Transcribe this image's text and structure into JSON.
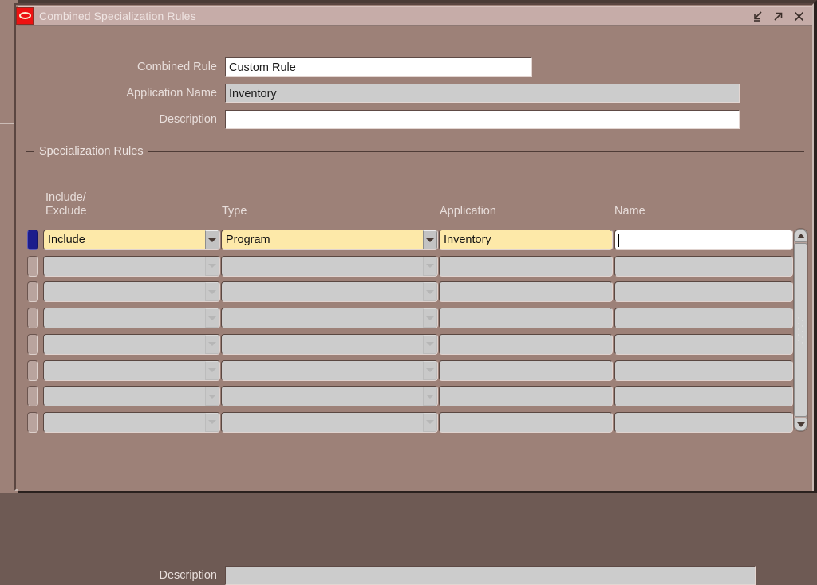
{
  "window": {
    "title": "Combined Specialization Rules",
    "logo_icon": "oracle-logo-icon",
    "controls": [
      {
        "name": "minimize",
        "icon": "minimize-arrow-icon"
      },
      {
        "name": "maximize",
        "icon": "maximize-arrow-icon"
      },
      {
        "name": "close",
        "icon": "close-x-icon"
      }
    ]
  },
  "colors": {
    "canvas": "#9d8178",
    "titlebar": "#c6aca8",
    "field_active": "#ffffff",
    "field_readonly": "#cccccc",
    "field_highlight": "#fde9a9",
    "record_indicator": "#1c1c8c",
    "label_text": "#e8dedb"
  },
  "header_fields": [
    {
      "label": "Combined Rule",
      "value": "Custom Rule",
      "state": "editable"
    },
    {
      "label": "Application Name",
      "value": "Inventory",
      "state": "readonly"
    },
    {
      "label": "Description",
      "value": "",
      "state": "editable"
    }
  ],
  "group": {
    "title": "Specialization Rules"
  },
  "grid": {
    "columns": [
      {
        "key": "include_exclude",
        "label_line1": "Include/",
        "label_line2": "Exclude"
      },
      {
        "key": "type",
        "label_line1": "Type",
        "label_line2": ""
      },
      {
        "key": "application",
        "label_line1": "Application",
        "label_line2": ""
      },
      {
        "key": "name",
        "label_line1": "Name",
        "label_line2": ""
      }
    ],
    "rows": [
      {
        "current": true,
        "include_exclude": "Include",
        "type": "Program",
        "application": "Inventory",
        "name": ""
      },
      {
        "current": false,
        "include_exclude": "",
        "type": "",
        "application": "",
        "name": ""
      },
      {
        "current": false,
        "include_exclude": "",
        "type": "",
        "application": "",
        "name": ""
      },
      {
        "current": false,
        "include_exclude": "",
        "type": "",
        "application": "",
        "name": ""
      },
      {
        "current": false,
        "include_exclude": "",
        "type": "",
        "application": "",
        "name": ""
      },
      {
        "current": false,
        "include_exclude": "",
        "type": "",
        "application": "",
        "name": ""
      },
      {
        "current": false,
        "include_exclude": "",
        "type": "",
        "application": "",
        "name": ""
      },
      {
        "current": false,
        "include_exclude": "",
        "type": "",
        "application": "",
        "name": ""
      }
    ],
    "scrollbar": {
      "up_icon": "scroll-up-arrow-icon",
      "down_icon": "scroll-down-arrow-icon",
      "thumb_position": "top"
    }
  },
  "footer": {
    "description_label": "Description",
    "description_value": "",
    "description_state": "readonly"
  }
}
